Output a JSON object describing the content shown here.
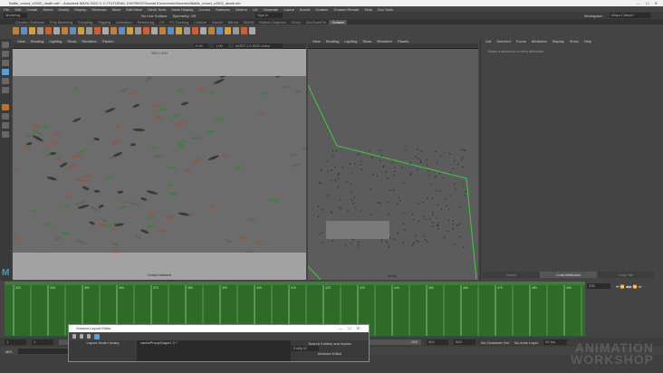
{
  "window": {
    "title": "Battle_crowd_v2002_death.mb* - Autodesk MAYA 2022.3: C:\\TUTORIAL DIVORKS\\Tutorial Environment\\scenes\\Battle_crowd_v2002_death.mb",
    "controls": [
      "—",
      "☐",
      "✕"
    ]
  },
  "menu": [
    "File",
    "Edit",
    "Create",
    "Select",
    "Modify",
    "Display",
    "Windows",
    "Mesh",
    "Edit Mesh",
    "Mesh Tools",
    "Mesh Display",
    "Curves",
    "Surfaces",
    "Deform",
    "UV",
    "Generate",
    "Cache",
    "Arnold",
    "Golaem",
    "Golaem Render",
    "Help",
    "Zoo Tools"
  ],
  "status": {
    "mode": "Modeling",
    "live_surface": "No Live Surface",
    "symmetry": "Symmetry: Off",
    "sign_in": "Sign In",
    "workspace_label": "Workspace :",
    "workspace": "Maya Classic*"
  },
  "shelf_tabs": [
    "Curves / Surfaces",
    "Poly Modeling",
    "Sculpting",
    "Rigging",
    "Animation",
    "Rendering",
    "FX",
    "FX Caching",
    "Custom",
    "Arnold",
    "Bifrost",
    "MASH",
    "Motion Graphics",
    "XGen",
    "ZooToolsPro",
    "Golaem"
  ],
  "shelf_active": "Golaem",
  "viewport1": {
    "menu": [
      "View",
      "Shading",
      "Lighting",
      "Show",
      "Renderer",
      "Panels"
    ],
    "colorspace": "ACES 1.0 SDR-video (sRGB)",
    "val1": "0.00",
    "val2": "1.00",
    "resolution": "960 x 540",
    "camera": "Crowd camera"
  },
  "viewport2": {
    "menu": [
      "View",
      "Shading",
      "Lighting",
      "Show",
      "Renderer",
      "Panels"
    ],
    "camera": "persp"
  },
  "attribute_editor": {
    "menu": [
      "List",
      "Selected",
      "Focus",
      "Attributes",
      "Display",
      "Show",
      "Help"
    ],
    "message": "Make a selection to view attributes",
    "buttons": [
      "Select",
      "Load Attributes",
      "Copy Tab"
    ]
  },
  "timeline": {
    "ticks": [
      "330",
      "340",
      "350",
      "360",
      "370",
      "380",
      "390",
      "400",
      "410",
      "420",
      "430",
      "440",
      "450",
      "460",
      "470",
      "480",
      "490"
    ],
    "current_frame": "330"
  },
  "range": {
    "start": "1",
    "start2": "1",
    "end_field": "500",
    "end": "500",
    "end2": "500",
    "character_set": "No Character Set",
    "anim_layer": "No Anim Layer",
    "fps": "30 fps"
  },
  "command": {
    "label": "MEL"
  },
  "golaem": {
    "title": "Golaem Layout Editor",
    "left_panel": "Layout Node Library",
    "tab": "cacheProxyShape1 0 *",
    "right_panel": "Search Entities and Nodes",
    "entity_dropdown": "Entity ID",
    "attr_editor": "Attribute Editor"
  },
  "watermark": [
    "ANIMATION",
    "WORKSHOP"
  ],
  "colors": {
    "timeline": "#2e6b2a",
    "camera_frustum": "#3ccf3c",
    "accent": "#5aa0d8"
  }
}
